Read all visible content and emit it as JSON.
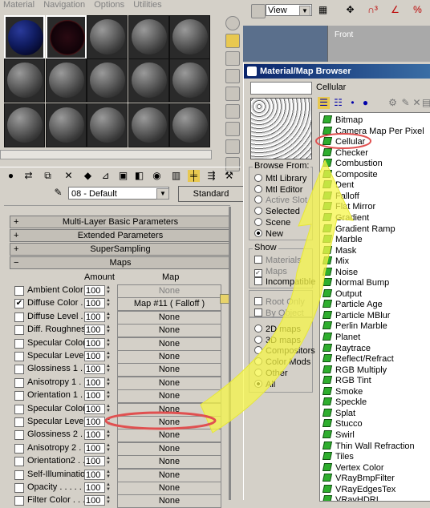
{
  "editor": {
    "menu": [
      "Material",
      "Navigation",
      "Options",
      "Utilities"
    ],
    "material_name": "08 - Default",
    "type_button": "Standard",
    "rollouts": [
      "Multi-Layer Basic Parameters",
      "Extended Parameters",
      "SuperSampling",
      "Maps"
    ],
    "rollout_signs": [
      "+",
      "+",
      "+",
      "−"
    ],
    "maps_header": {
      "amount": "Amount",
      "map": "Map"
    },
    "map_rows": [
      {
        "label": "Ambient Color .",
        "checked": false,
        "amount": "100",
        "map": "None",
        "dim": true
      },
      {
        "label": "Diffuse Color . . .",
        "checked": true,
        "amount": "100",
        "map": "Map #11  ( Falloff )",
        "dim": false
      },
      {
        "label": "Diffuse Level . . .",
        "checked": false,
        "amount": "100",
        "map": "None",
        "dim": false
      },
      {
        "label": "Diff. Roughness .",
        "checked": false,
        "amount": "100",
        "map": "None",
        "dim": false
      },
      {
        "label": "Specular Color 1",
        "checked": false,
        "amount": "100",
        "map": "None",
        "dim": false
      },
      {
        "label": "Specular Level 1",
        "checked": false,
        "amount": "100",
        "map": "None",
        "dim": false
      },
      {
        "label": "Glossiness 1 . . .",
        "checked": false,
        "amount": "100",
        "map": "None",
        "dim": false
      },
      {
        "label": "Anisotropy 1 . . .",
        "checked": false,
        "amount": "100",
        "map": "None",
        "dim": false
      },
      {
        "label": "Orientation 1 . . .",
        "checked": false,
        "amount": "100",
        "map": "None",
        "dim": false
      },
      {
        "label": "Specular Color 2",
        "checked": false,
        "amount": "100",
        "map": "None",
        "dim": false
      },
      {
        "label": "Specular Level 2",
        "checked": false,
        "amount": "100",
        "map": "None",
        "dim": false
      },
      {
        "label": "Glossiness 2 . . .",
        "checked": false,
        "amount": "100",
        "map": "None",
        "dim": false
      },
      {
        "label": "Anisotropy 2 . . .",
        "checked": false,
        "amount": "100",
        "map": "None",
        "dim": false
      },
      {
        "label": "Orientation2 . . .",
        "checked": false,
        "amount": "100",
        "map": "None",
        "dim": false
      },
      {
        "label": "Self-Illumination .",
        "checked": false,
        "amount": "100",
        "map": "None",
        "dim": false
      },
      {
        "label": "Opacity . . . . . .",
        "checked": false,
        "amount": "100",
        "map": "None",
        "dim": false
      },
      {
        "label": "Filter Color . . .",
        "checked": false,
        "amount": "100",
        "map": "None",
        "dim": false
      }
    ]
  },
  "viewport": {
    "view_select": "View",
    "label": "Front"
  },
  "browser": {
    "title": "Material/Map Browser",
    "current": "Cellular",
    "browse_from": {
      "title": "Browse From:",
      "options": [
        {
          "label": "Mtl Library",
          "on": false,
          "dim": false
        },
        {
          "label": "Mtl Editor",
          "on": false,
          "dim": false
        },
        {
          "label": "Active Slot",
          "on": false,
          "dim": true
        },
        {
          "label": "Selected",
          "on": false,
          "dim": false
        },
        {
          "label": "Scene",
          "on": false,
          "dim": false
        },
        {
          "label": "New",
          "on": true,
          "dim": false
        }
      ]
    },
    "show": {
      "title": "Show",
      "options": [
        {
          "label": "Materials",
          "checked": false,
          "dim": true
        },
        {
          "label": "Maps",
          "checked": true,
          "dim": true
        },
        {
          "label": "Incompatible",
          "checked": false,
          "dim": false
        }
      ]
    },
    "root": {
      "options": [
        {
          "label": "Root Only",
          "checked": false,
          "dim": true
        },
        {
          "label": "By Object",
          "checked": false,
          "dim": true
        }
      ]
    },
    "filter": {
      "options": [
        {
          "label": "2D maps",
          "on": false
        },
        {
          "label": "3D maps",
          "on": false
        },
        {
          "label": "Compositors",
          "on": false
        },
        {
          "label": "Color Mods",
          "on": false
        },
        {
          "label": "Other",
          "on": false
        },
        {
          "label": "All",
          "on": true
        }
      ]
    },
    "maps": [
      "Bitmap",
      "Camera Map Per Pixel",
      "Cellular",
      "Checker",
      "Combustion",
      "Composite",
      "Dent",
      "Falloff",
      "Flat Mirror",
      "Gradient",
      "Gradient Ramp",
      "Marble",
      "Mask",
      "Mix",
      "Noise",
      "Normal Bump",
      "Output",
      "Particle Age",
      "Particle MBlur",
      "Perlin Marble",
      "Planet",
      "Raytrace",
      "Reflect/Refract",
      "RGB Multiply",
      "RGB Tint",
      "Smoke",
      "Speckle",
      "Splat",
      "Stucco",
      "Swirl",
      "Thin Wall Refraction",
      "Tiles",
      "Vertex Color",
      "VRayBmpFilter",
      "VRayEdgesTex",
      "VRayHDRI"
    ]
  },
  "colors": {
    "title_bar": "#0a246a",
    "map_icon": "#2eae2e",
    "arrow": "#f5f54a",
    "highlight_ring": "#e05050"
  }
}
